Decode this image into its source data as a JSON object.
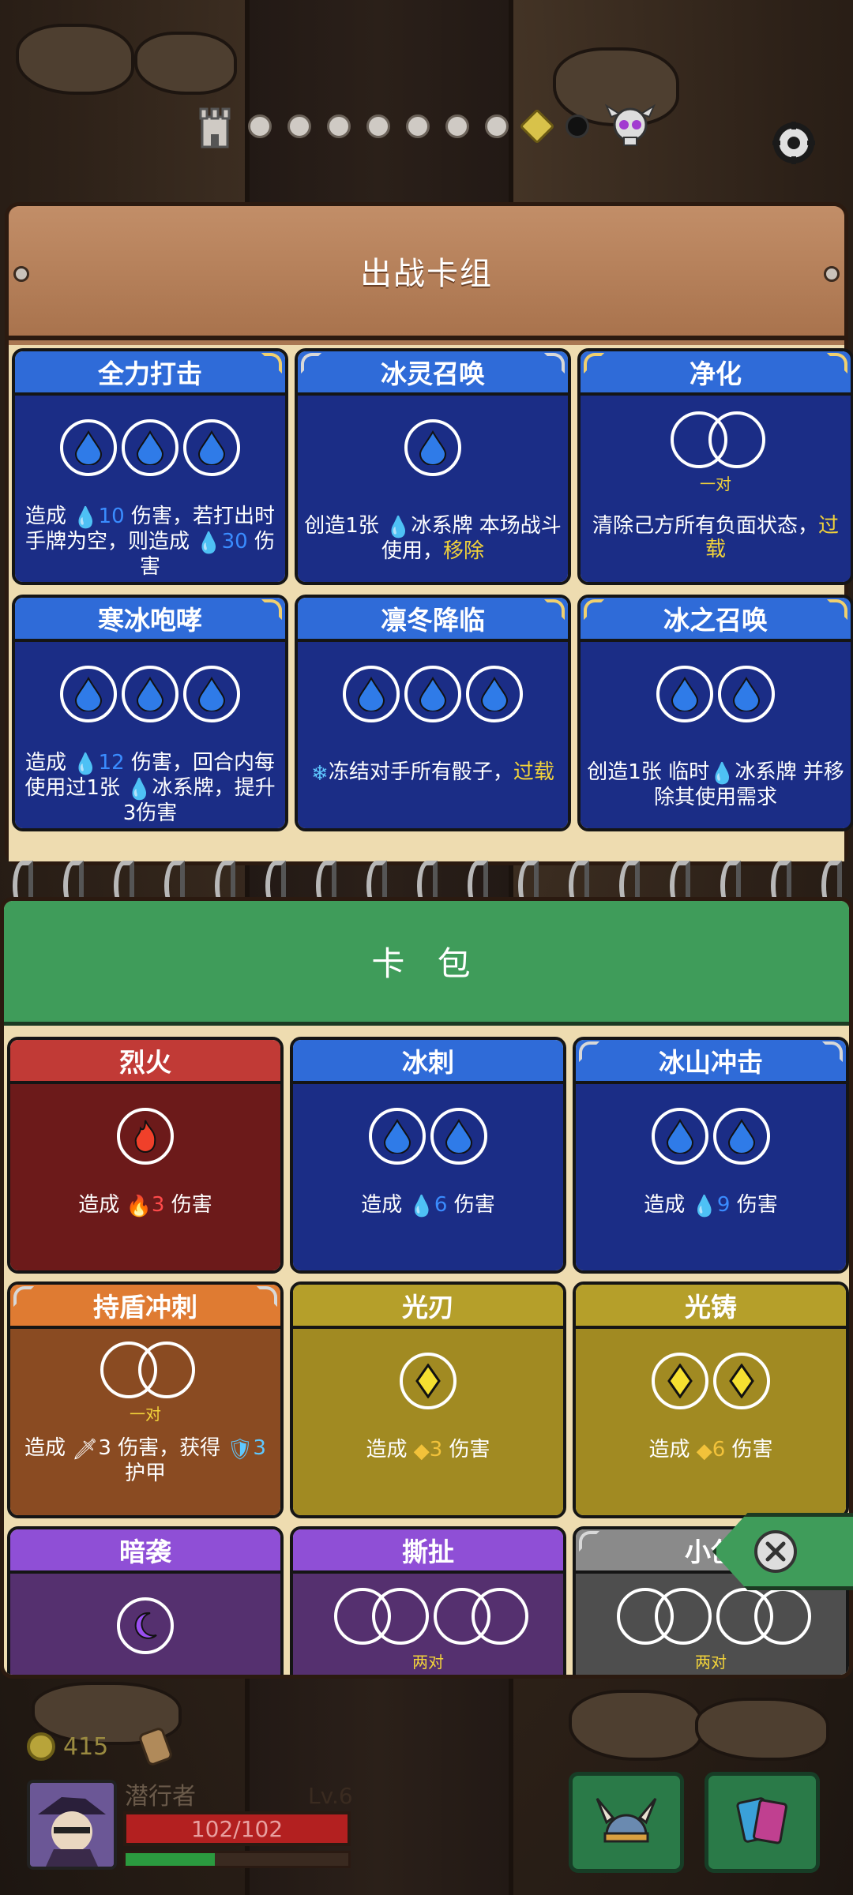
{
  "colors": {
    "blue_banner": "#2f6bd8",
    "blue_body": "#1b2d86",
    "red_banner": "#c13a36",
    "gold_banner": "#b59f2a",
    "purple_banner": "#8f4fd6",
    "green_header": "#3f9c5a",
    "highlight": "#f2d33a"
  },
  "progress": {
    "icons": [
      "castle-icon",
      "skull-icon"
    ],
    "dots": 7
  },
  "deck": {
    "title": "出战卡组",
    "cards": [
      {
        "name": "全力打击",
        "dice": [
          "water-drop-icon",
          "water-drop-icon",
          "water-drop-icon"
        ],
        "desc": {
          "a": "造成 ",
          "n1": "10",
          "b": " 伤害，若打出时手牌为空，则造成 ",
          "n2": "30",
          "c": " 伤害"
        }
      },
      {
        "name": "冰灵召唤",
        "dice": [
          "water-drop-icon"
        ],
        "desc": {
          "a": "创造1张 ",
          "b": "冰系牌 本场战斗使用，",
          "hl": "移除"
        }
      },
      {
        "name": "净化",
        "pair_label": "一对",
        "desc": {
          "a": "清除己方所有负面状态，",
          "hl": "过载"
        }
      },
      {
        "name": "寒冰咆哮",
        "dice": [
          "water-drop-icon",
          "water-drop-icon",
          "water-drop-icon"
        ],
        "desc": {
          "a": "造成 ",
          "n1": "12",
          "b": " 伤害，回合内每使用过1张 ",
          "c": "冰系牌，提升3伤害"
        }
      },
      {
        "name": "凛冬降临",
        "dice": [
          "water-drop-icon",
          "water-drop-icon",
          "water-drop-icon"
        ],
        "desc": {
          "a": "冻结对手所有骰子，",
          "hl": "过载"
        }
      },
      {
        "name": "冰之召唤",
        "dice": [
          "water-drop-icon",
          "water-drop-icon"
        ],
        "desc": {
          "a": "创造1张 临时",
          "b": "冰系牌 并移除其使用需求"
        }
      }
    ]
  },
  "pack": {
    "title": "卡 包",
    "cards": [
      {
        "name": "烈火",
        "desc": {
          "a": "造成 ",
          "n": "3",
          "b": " 伤害"
        }
      },
      {
        "name": "冰刺",
        "desc": {
          "a": "造成 ",
          "n": "6",
          "b": " 伤害"
        }
      },
      {
        "name": "冰山冲击",
        "desc": {
          "a": "造成 ",
          "n": "9",
          "b": " 伤害"
        }
      },
      {
        "name": "持盾冲刺",
        "pair_label": "一对",
        "desc": {
          "a": "造成 ",
          "n": "3",
          "b": " 伤害，获得 ",
          "n2": "3",
          "c": "护甲"
        }
      },
      {
        "name": "光刃",
        "desc": {
          "a": "造成 ",
          "n": "3",
          "b": " 伤害"
        }
      },
      {
        "name": "光铸",
        "desc": {
          "a": "造成 ",
          "n": "6",
          "b": " 伤害"
        }
      },
      {
        "name": "暗袭"
      },
      {
        "name": "撕扯",
        "pair_label": "两对"
      },
      {
        "name": "小创",
        "pair_label": "两对"
      }
    ]
  },
  "player": {
    "coins": "415",
    "name": "潜行者",
    "level": "Lv.6",
    "hp": "102/102",
    "xp_fraction": 0.4
  }
}
